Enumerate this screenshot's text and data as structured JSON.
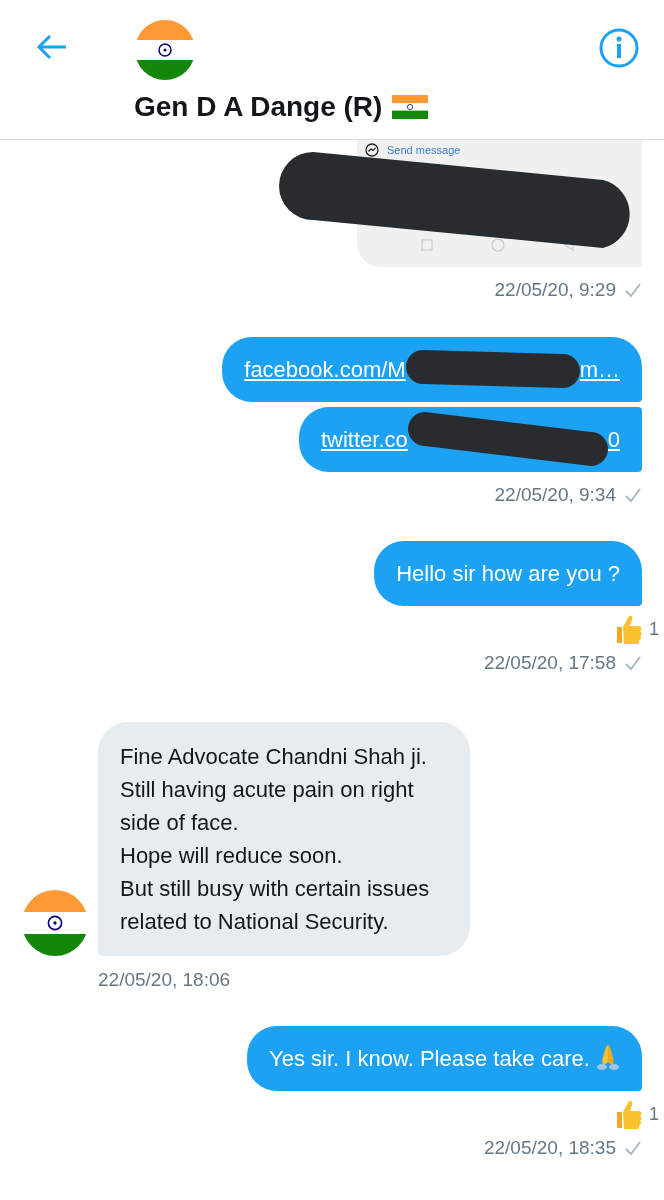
{
  "header": {
    "name": "Gen D A Dange (R)"
  },
  "groups": [
    {
      "outgoing": true,
      "bubbles": [
        {
          "kind": "image",
          "caption": "Send message"
        }
      ],
      "timestamp": "22/05/20, 9:29",
      "read": false
    },
    {
      "outgoing": true,
      "bubbles": [
        {
          "kind": "link",
          "parts": [
            "facebook.com/M",
            "m…"
          ]
        },
        {
          "kind": "link",
          "parts": [
            "twitter.co",
            "0"
          ]
        }
      ],
      "timestamp": "22/05/20, 9:34",
      "read": false
    },
    {
      "outgoing": true,
      "bubbles": [
        {
          "kind": "text",
          "text": "Hello sir how are you ?"
        }
      ],
      "reaction": {
        "count": "1"
      },
      "timestamp": "22/05/20, 17:58",
      "read": false
    },
    {
      "outgoing": false,
      "bubbles": [
        {
          "kind": "text",
          "text": "Fine Advocate Chandni Shah ji.\nStill having acute pain on right side of face.\nHope will reduce soon.\nBut still busy with certain issues related to National Security."
        }
      ],
      "timestamp": "22/05/20, 18:06"
    },
    {
      "outgoing": true,
      "bubbles": [
        {
          "kind": "text",
          "text": "Yes sir. I know. Please take care.",
          "praying_hands": true
        }
      ],
      "reaction": {
        "count": "1"
      },
      "timestamp": "22/05/20, 18:35",
      "read": false
    }
  ]
}
